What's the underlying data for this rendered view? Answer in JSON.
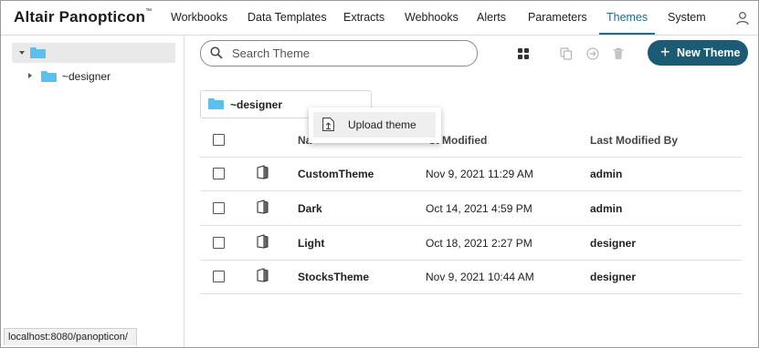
{
  "app": {
    "brand": "Altair Panopticon",
    "trademark": "™"
  },
  "nav": {
    "items": [
      {
        "label": "Workbooks",
        "active": false
      },
      {
        "label": "Data Templates",
        "active": false
      },
      {
        "label": "Extracts",
        "active": false
      },
      {
        "label": "Webhooks",
        "active": false
      },
      {
        "label": "Alerts",
        "active": false
      },
      {
        "label": "Parameters",
        "active": false
      },
      {
        "label": "Themes",
        "active": true
      },
      {
        "label": "System",
        "active": false
      }
    ],
    "user_icon": "user-icon"
  },
  "sidebar": {
    "root": {
      "label": ""
    },
    "children": [
      {
        "label": "~designer"
      }
    ]
  },
  "toolbar": {
    "search": {
      "placeholder": "Search Theme",
      "value": ""
    },
    "icons": [
      "grid-view-icon",
      "copy-icon",
      "move-icon",
      "delete-icon"
    ],
    "new_button": {
      "label": "New Theme"
    }
  },
  "folder_chip": {
    "label": "~designer"
  },
  "context_menu": {
    "items": [
      {
        "label": "Upload theme",
        "icon": "upload-icon"
      }
    ]
  },
  "table": {
    "columns": {
      "name": "Na",
      "modified": "st Modified",
      "modified_by": "Last Modified By"
    },
    "rows": [
      {
        "name": "CustomTheme",
        "modified": "Nov 9, 2021 11:29 AM",
        "modified_by": "admin"
      },
      {
        "name": "Dark",
        "modified": "Oct 14, 2021 4:59 PM",
        "modified_by": "admin"
      },
      {
        "name": "Light",
        "modified": "Oct 18, 2021 2:27 PM",
        "modified_by": "designer"
      },
      {
        "name": "StocksTheme",
        "modified": "Nov 9, 2021 10:44 AM",
        "modified_by": "designer"
      }
    ]
  },
  "status_bar": {
    "url": "localhost:8080/panopticon/"
  },
  "colors": {
    "accent": "#1d6f8a",
    "button": "#1d5b75",
    "folder": "#5bc0eb"
  }
}
